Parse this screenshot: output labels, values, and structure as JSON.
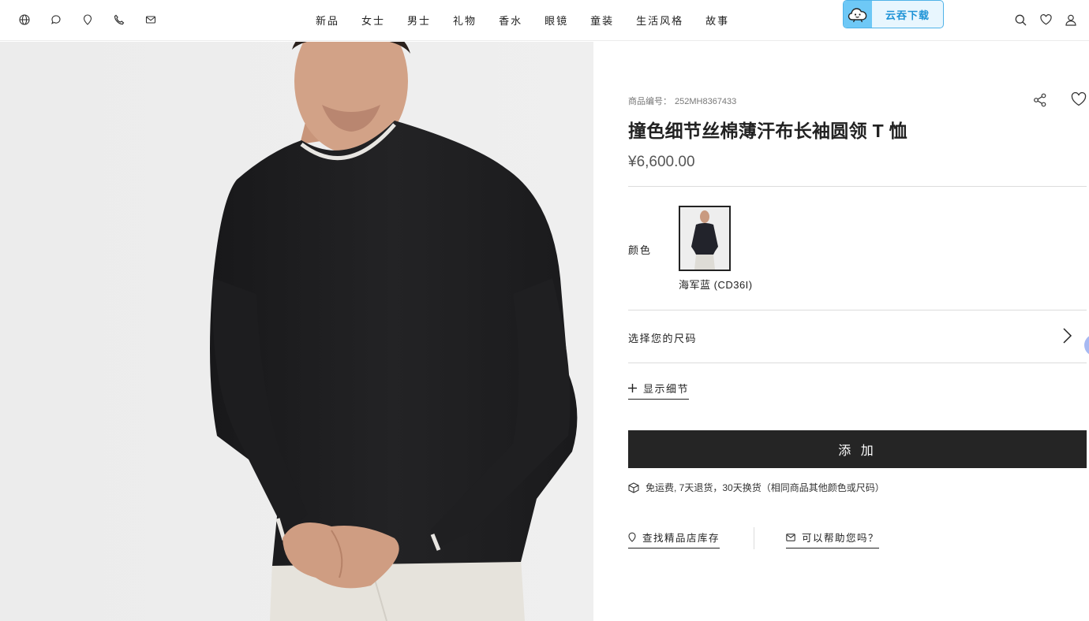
{
  "header": {
    "utility_icons": [
      "globe-icon",
      "chat-icon",
      "location-icon",
      "phone-icon",
      "mail-icon"
    ],
    "nav": [
      {
        "label": "新品"
      },
      {
        "label": "女士"
      },
      {
        "label": "男士"
      },
      {
        "label": "礼物"
      },
      {
        "label": "香水"
      },
      {
        "label": "眼镜"
      },
      {
        "label": "童装"
      },
      {
        "label": "生活风格"
      },
      {
        "label": "故事"
      }
    ],
    "download_label": "云吞下载",
    "right_icons": [
      "search-icon",
      "heart-icon",
      "user-icon"
    ]
  },
  "product": {
    "sku_label": "商品编号：",
    "sku_value": "252MH8367433",
    "title": "撞色细节丝棉薄汗布长袖圆领 T 恤",
    "price": "¥6,600.00",
    "color_label": "颜色",
    "color_name": "海军蓝 (CD36I)",
    "size_label": "选择您的尺码",
    "details_label": "显示细节",
    "add_label": "添 加",
    "shipping_text": "免运费, 7天退货，30天换货（相同商品其他颜色或尺码）",
    "store_link": "查找精品店库存",
    "help_link": "可以帮助您吗？"
  },
  "colors": {
    "button_bg": "#252525",
    "download_accent": "#1e93d6",
    "shirt": "#1d1d1f"
  }
}
